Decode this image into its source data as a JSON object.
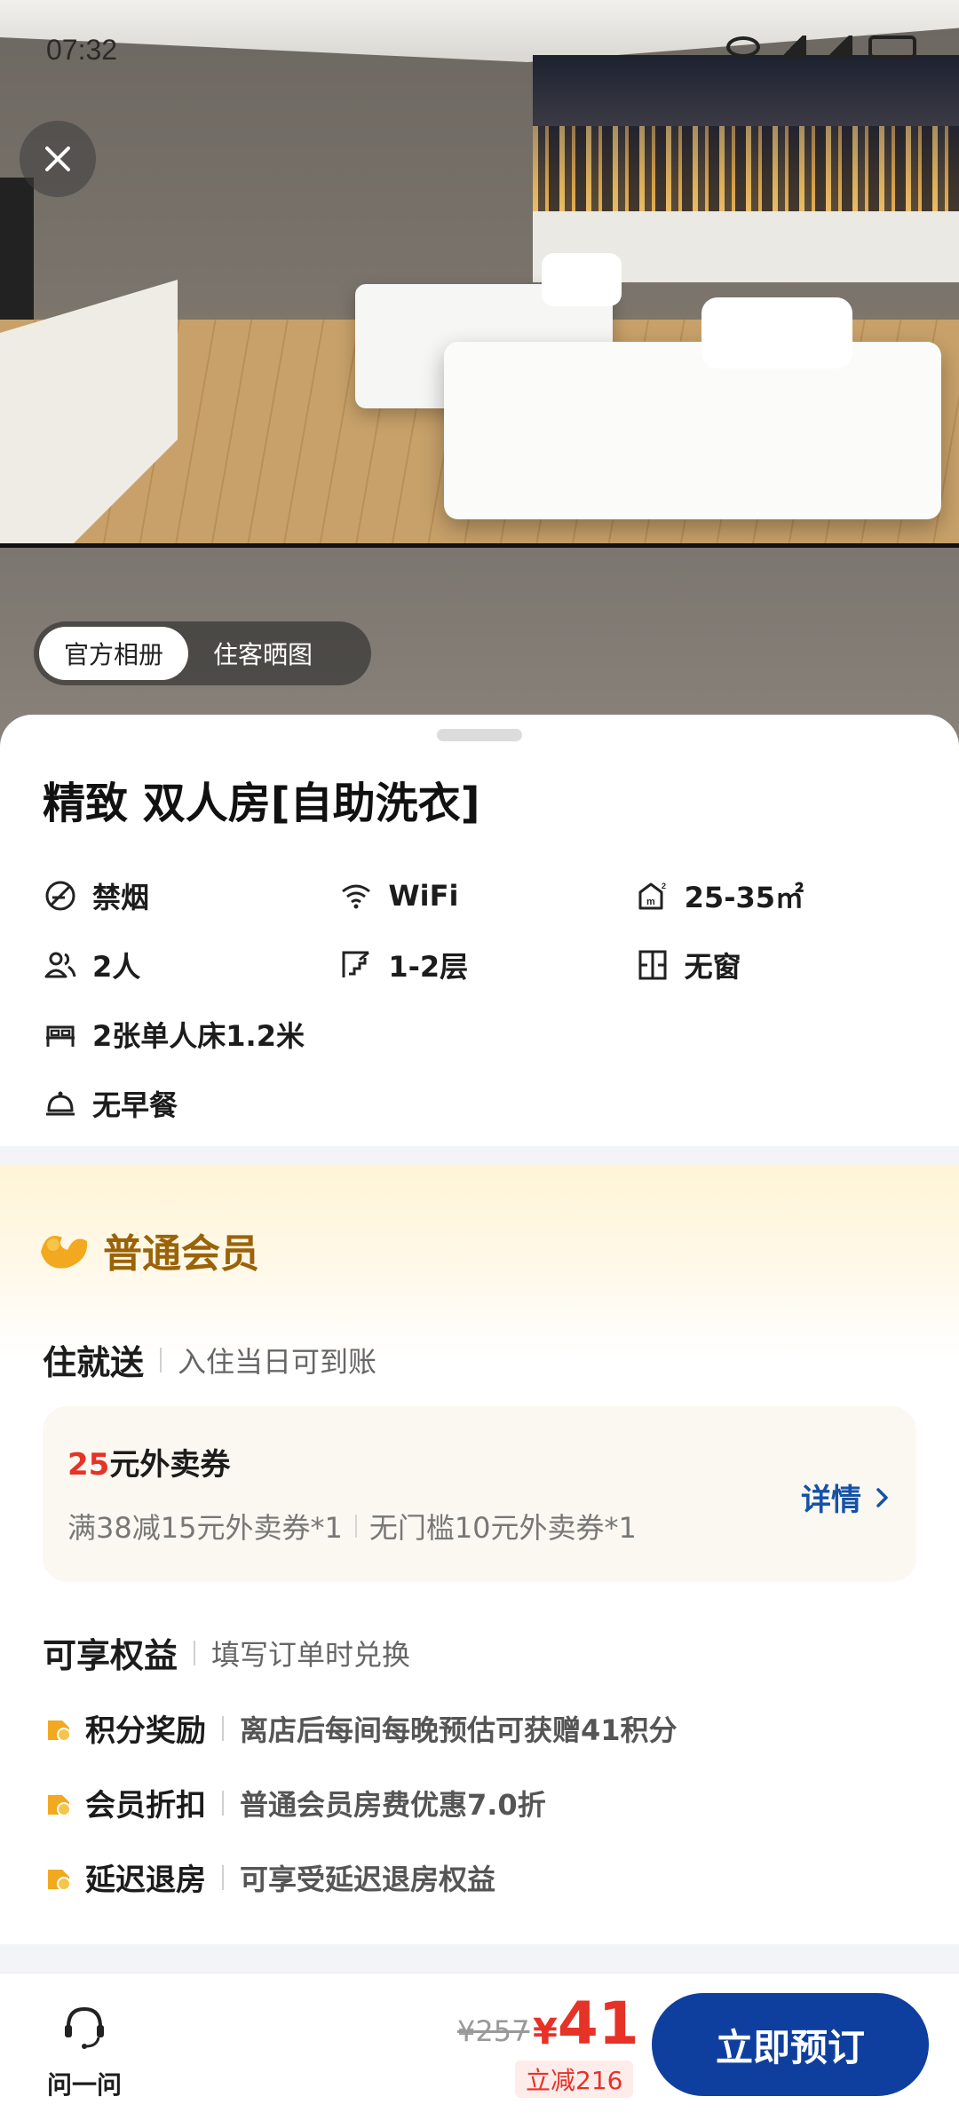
{
  "status_bar": {
    "time": "07:32"
  },
  "gallery": {
    "tabs": [
      {
        "label": "官方相册",
        "active": true
      },
      {
        "label": "住客晒图",
        "active": false
      }
    ]
  },
  "room": {
    "title": "精致 双人房[自助洗衣]",
    "facilities": [
      {
        "icon": "no-smoking-icon",
        "label": "禁烟"
      },
      {
        "icon": "wifi-icon",
        "label": "WiFi"
      },
      {
        "icon": "area-icon",
        "label": "25-35㎡"
      },
      {
        "icon": "people-icon",
        "label": "2人"
      },
      {
        "icon": "floor-icon",
        "label": "1-2层"
      },
      {
        "icon": "window-icon",
        "label": "无窗"
      },
      {
        "icon": "bed-icon",
        "label": "2张单人床1.2米"
      },
      {
        "icon": "breakfast-icon",
        "label": "无早餐"
      }
    ]
  },
  "member": {
    "title": "普通会员",
    "stay_gift": {
      "heading": "住就送",
      "desc": "入住当日可到账",
      "coupon": {
        "amount": "25",
        "title_suffix": "元外卖券",
        "item1": "满38减15元外卖券*1",
        "item2": "无门槛10元外卖券*1",
        "detail_label": "详情"
      }
    },
    "benefits": {
      "heading": "可享权益",
      "desc": "填写订单时兑换",
      "items": [
        {
          "name": "积分奖励",
          "desc": "离店后每间每晚预估可获赠41积分"
        },
        {
          "name": "会员折扣",
          "desc": "普通会员房费优惠7.0折"
        },
        {
          "name": "延迟退房",
          "desc": "可享受延迟退房权益"
        }
      ]
    }
  },
  "bottom_bar": {
    "ask_label": "问一问",
    "original_price": "¥257",
    "currency": "¥",
    "price": "41",
    "discount": "立减216",
    "book_label": "立即预订"
  },
  "colors": {
    "accent_blue": "#0f3f9e",
    "price_red": "#e63227",
    "member_gold": "#9a6308"
  }
}
